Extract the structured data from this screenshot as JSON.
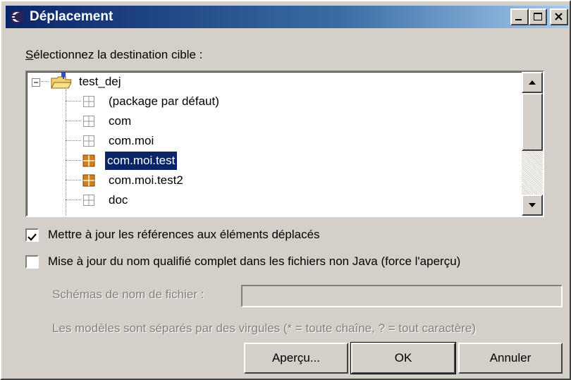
{
  "window": {
    "title": "Déplacement",
    "icon": "eclipse-app-icon"
  },
  "prompt": {
    "text": "électionnez la destination cible :",
    "mnemonic": "S"
  },
  "tree": {
    "root": {
      "label": "test_dej",
      "icon": "project-folder-icon",
      "expanded": true
    },
    "items": [
      {
        "label": "(package par défaut)",
        "icon": "empty-package-icon",
        "selected": false
      },
      {
        "label": "com",
        "icon": "empty-package-icon",
        "selected": false
      },
      {
        "label": "com.moi",
        "icon": "empty-package-icon",
        "selected": false
      },
      {
        "label": "com.moi.test",
        "icon": "package-icon",
        "selected": true
      },
      {
        "label": "com.moi.test2",
        "icon": "package-icon",
        "selected": false
      },
      {
        "label": "doc",
        "icon": "empty-package-icon",
        "selected": false
      }
    ]
  },
  "options": {
    "update_refs": {
      "label": "Mettre à jour les références aux éléments déplacés",
      "checked": true
    },
    "update_qualified": {
      "label": "Mise à jour du nom qualifié complet dans les fichiers non Java (force l'aperçu)",
      "checked": false
    }
  },
  "patterns": {
    "label": "Schémas de nom de fichier :",
    "value": "",
    "hint": "Les modèles sont séparés par des virgules (* = toute chaîne, ? = tout caractère)"
  },
  "buttons": {
    "preview": "Aperçu...",
    "ok": "OK",
    "cancel": "Annuler"
  },
  "colors": {
    "title_start": "#0a246a",
    "title_end": "#a6caf0",
    "selection": "#0a246a",
    "face": "#d4d0c8"
  }
}
